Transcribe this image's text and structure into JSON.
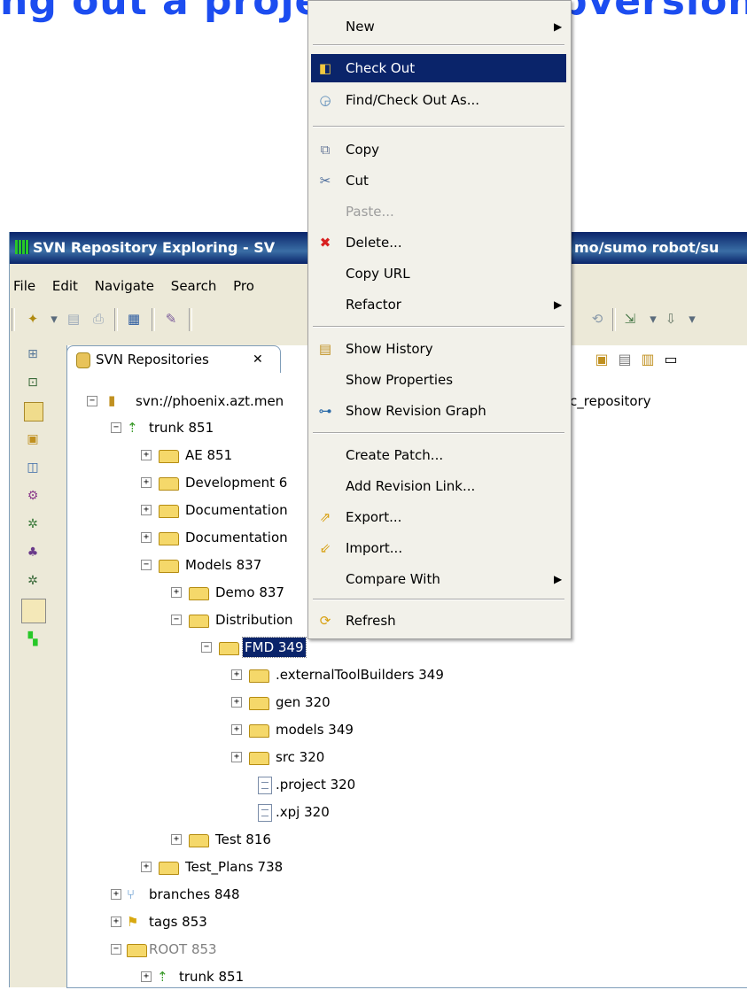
{
  "heading": {
    "text": "ng out a project from Subversion"
  },
  "window": {
    "title_left": "SVN Repository Exploring - SV",
    "title_right": "mo/sumo robot/su"
  },
  "menubar": [
    "File",
    "Edit",
    "Navigate",
    "Search",
    "Pro"
  ],
  "view": {
    "tab_label": "SVN Repositories",
    "close_symbol": "✕"
  },
  "tree": {
    "root_label": "svn://phoenix.azt.men",
    "root_label_tail": "c_repository",
    "items": [
      {
        "label": "trunk 851"
      },
      {
        "label": "AE 851"
      },
      {
        "label": "Development 6"
      },
      {
        "label": "Documentation"
      },
      {
        "label": "Documentation"
      },
      {
        "label": "Models 837"
      },
      {
        "label": "Demo 837"
      },
      {
        "label": "Distribution"
      },
      {
        "label": "FMD 349"
      },
      {
        "label": ".externalToolBuilders 349"
      },
      {
        "label": "gen 320"
      },
      {
        "label": "models 349"
      },
      {
        "label": "src 320"
      },
      {
        "label": ".project 320"
      },
      {
        "label": ".xpj 320"
      },
      {
        "label": "Test 816"
      },
      {
        "label": "Test_Plans 738"
      },
      {
        "label": "branches 848"
      },
      {
        "label": "tags 853"
      },
      {
        "label": "ROOT 853"
      },
      {
        "label": "trunk 851"
      }
    ]
  },
  "context_menu": {
    "items": [
      {
        "label": "New",
        "submenu": true
      },
      {
        "label": "Check Out",
        "highlighted": true
      },
      {
        "label": "Find/Check Out As..."
      },
      {
        "label": "Copy"
      },
      {
        "label": "Cut"
      },
      {
        "label": "Paste...",
        "disabled": true
      },
      {
        "label": "Delete..."
      },
      {
        "label": "Copy URL"
      },
      {
        "label": "Refactor",
        "submenu": true
      },
      {
        "label": "Show History"
      },
      {
        "label": "Show Properties"
      },
      {
        "label": "Show Revision Graph"
      },
      {
        "label": "Create Patch..."
      },
      {
        "label": "Add Revision Link..."
      },
      {
        "label": "Export..."
      },
      {
        "label": "Import..."
      },
      {
        "label": "Compare With",
        "submenu": true
      },
      {
        "label": "Refresh"
      }
    ]
  },
  "colors": {
    "accent": "#1c4df0",
    "selection": "#0a246a",
    "titlebar": "#0a246a"
  }
}
